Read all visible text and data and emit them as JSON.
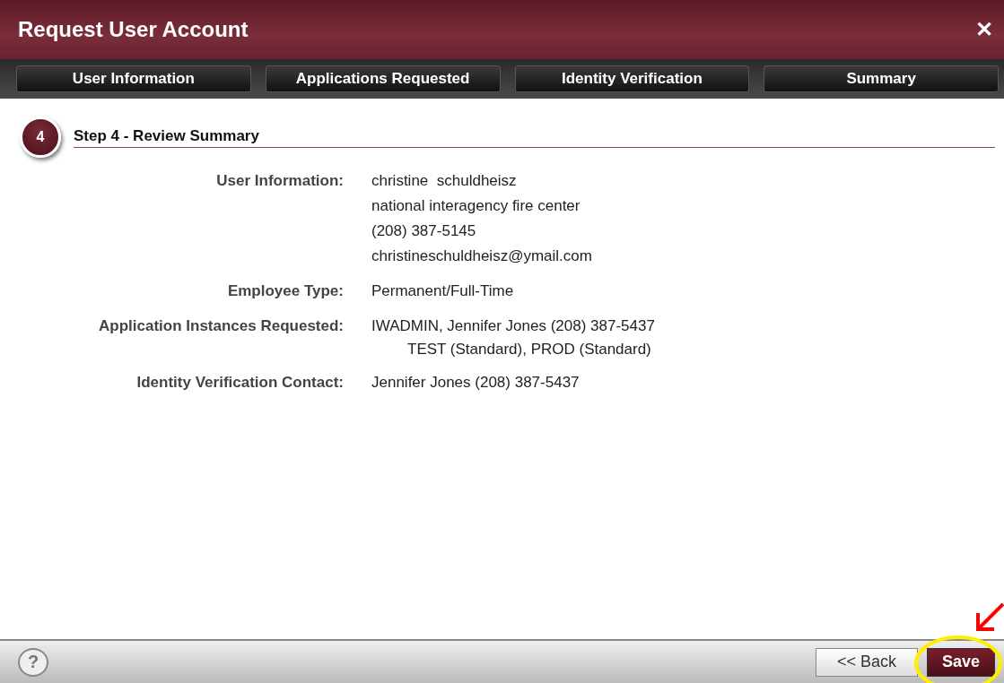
{
  "window": {
    "title": "Request User Account",
    "close": "✕"
  },
  "tabs": [
    {
      "label": "User Information"
    },
    {
      "label": "Applications Requested"
    },
    {
      "label": "Identity Verification"
    },
    {
      "label": "Summary"
    }
  ],
  "step": {
    "number": "4",
    "title": "Step 4 - Review Summary"
  },
  "summary": [
    {
      "label": "User Information:",
      "lines": [
        "christine  schuldheisz",
        "national interagency fire center",
        "(208) 387-5145",
        "christineschuldheisz@ymail.com"
      ]
    },
    {
      "label": "Employee Type:",
      "lines": [
        "Permanent/Full-Time"
      ]
    },
    {
      "label": "Application Instances Requested:",
      "lines": [
        "IWADMIN, Jennifer Jones (208) 387-5437"
      ],
      "details": [
        "TEST (Standard), PROD (Standard)"
      ]
    },
    {
      "label": "Identity Verification Contact:",
      "lines": [
        "Jennifer Jones (208) 387-5437"
      ]
    }
  ],
  "footer": {
    "help": "?",
    "back": "<< Back",
    "save": "Save"
  }
}
